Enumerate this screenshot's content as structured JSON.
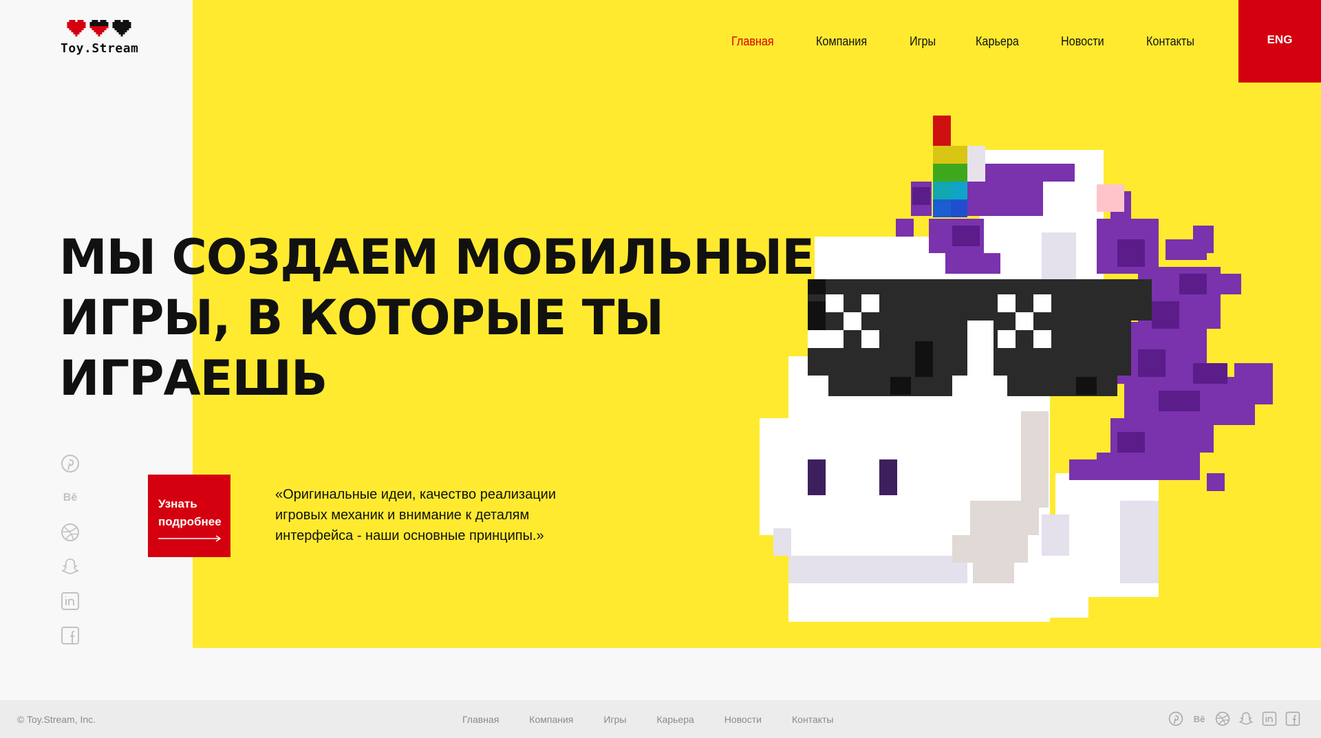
{
  "brand": {
    "name": "Toy.Stream",
    "accent_color": "#d4000f",
    "panel_color": "#ffea2f"
  },
  "header": {
    "nav": [
      {
        "label": "Главная",
        "active": true
      },
      {
        "label": "Компания",
        "active": false
      },
      {
        "label": "Игры",
        "active": false
      },
      {
        "label": "Карьера",
        "active": false
      },
      {
        "label": "Новости",
        "active": false
      },
      {
        "label": "Контакты",
        "active": false
      }
    ],
    "lang_button": "ENG"
  },
  "hero": {
    "headline_lines": [
      "Мы создаем мобильные",
      "игры, в которые ты",
      "играешь"
    ],
    "cta_line1": "Узнать",
    "cta_line2": "подробнее",
    "quote_lines": [
      "«Оригинальные идеи, качество реализации",
      "игровых механик и внимание к деталям",
      "интерфейса - наши основные принципы.»"
    ],
    "illustration": "pixel-unicorn-with-sunglasses"
  },
  "socials": [
    "pinterest-icon",
    "behance-icon",
    "dribbble-icon",
    "snapchat-icon",
    "linkedin-icon",
    "facebook-icon"
  ],
  "footer": {
    "copyright": "© Toy.Stream, Inc.",
    "nav": [
      "Главная",
      "Компания",
      "Игры",
      "Карьера",
      "Новости",
      "Контакты"
    ]
  }
}
